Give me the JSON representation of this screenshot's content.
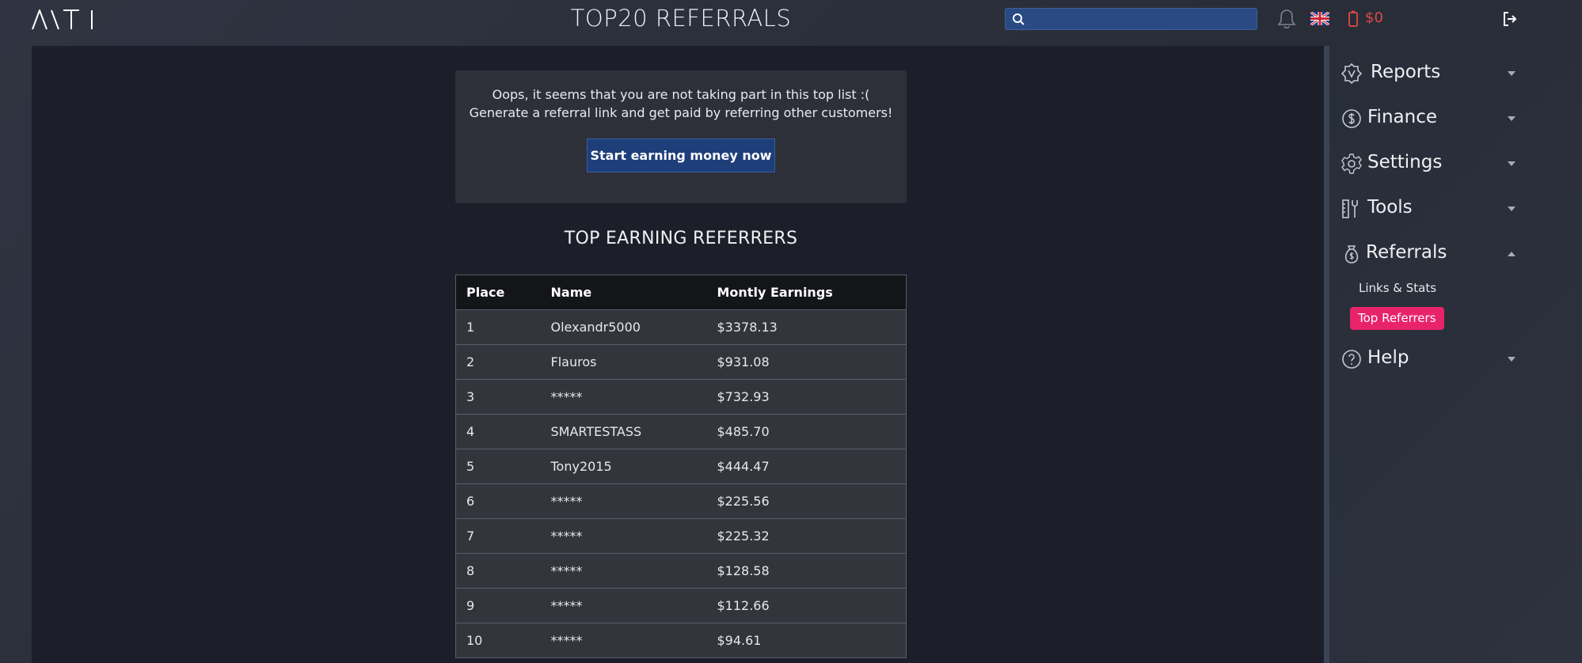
{
  "header": {
    "title": "TOP20 REFERRALS",
    "search_placeholder": "",
    "balance": "$0"
  },
  "notice": {
    "line1": "Oops, it seems that you are not taking part in this top list :(",
    "line2": "Generate a referral link and get paid by referring other customers!",
    "cta_label": "Start earning money now"
  },
  "section_title": "TOP EARNING REFERRERS",
  "table": {
    "columns": [
      "Place",
      "Name",
      "Montly Earnings"
    ],
    "rows": [
      [
        "1",
        "Olexandr5000",
        "$3378.13"
      ],
      [
        "2",
        "Flauros",
        "$931.08"
      ],
      [
        "3",
        "*****",
        "$732.93"
      ],
      [
        "4",
        "SMARTESTASS",
        "$485.70"
      ],
      [
        "5",
        "Tony2015",
        "$444.47"
      ],
      [
        "6",
        "*****",
        "$225.56"
      ],
      [
        "7",
        "*****",
        "$225.32"
      ],
      [
        "8",
        "*****",
        "$128.58"
      ],
      [
        "9",
        "*****",
        "$112.66"
      ],
      [
        "10",
        "*****",
        "$94.61"
      ]
    ]
  },
  "sidebar": {
    "items": [
      {
        "label": "Reports",
        "icon": "reports-icon",
        "expanded": false
      },
      {
        "label": "Finance",
        "icon": "dollar-icon",
        "expanded": false
      },
      {
        "label": "Settings",
        "icon": "gear-icon",
        "expanded": false
      },
      {
        "label": "Tools",
        "icon": "tools-icon",
        "expanded": false
      },
      {
        "label": "Referrals",
        "icon": "money-bag-icon",
        "expanded": true
      },
      {
        "label": "Help",
        "icon": "help-icon",
        "expanded": false
      }
    ],
    "referrals_sub": {
      "links_stats": "Links & Stats",
      "top_referrers": "Top Referrers"
    }
  },
  "colors": {
    "accent_active": "#e8236a",
    "cta_bg": "#1e3e7a",
    "balance": "#e04848",
    "search_bg": "#2a4a84"
  }
}
